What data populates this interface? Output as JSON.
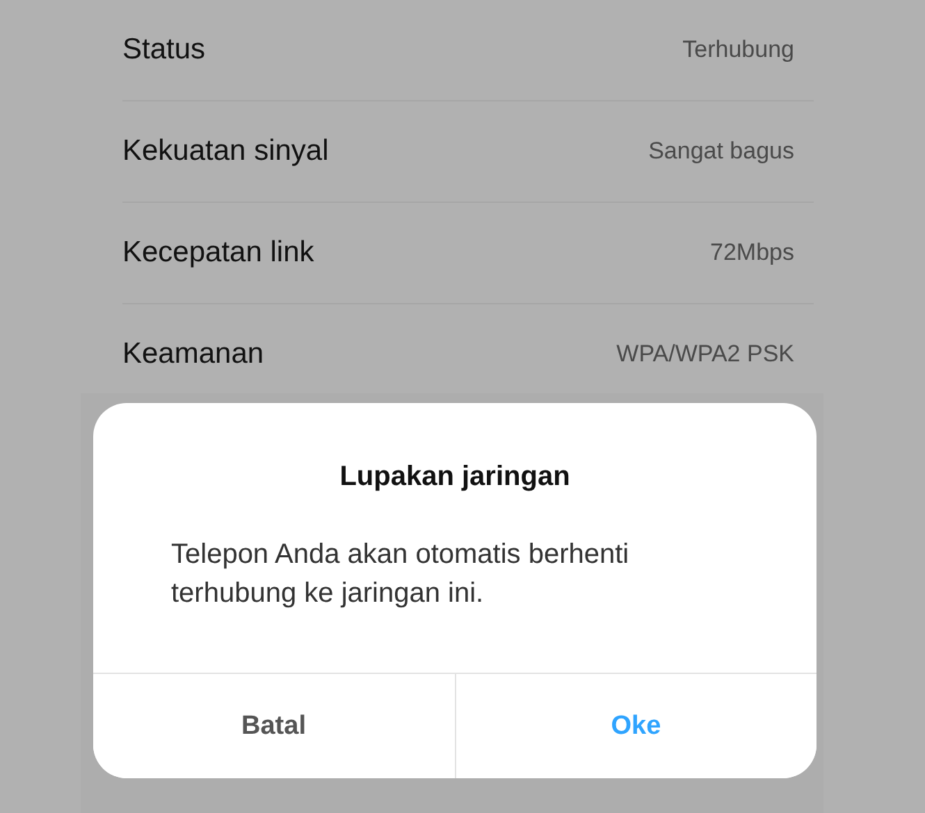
{
  "details": [
    {
      "label": "Status",
      "value": "Terhubung"
    },
    {
      "label": "Kekuatan sinyal",
      "value": "Sangat bagus"
    },
    {
      "label": "Kecepatan link",
      "value": "72Mbps"
    },
    {
      "label": "Keamanan",
      "value": "WPA/WPA2 PSK"
    }
  ],
  "dialog": {
    "title": "Lupakan jaringan",
    "message": "Telepon Anda akan otomatis berhenti terhubung ke jaringan ini.",
    "buttons": [
      {
        "label": "Batal",
        "kind": "cancel"
      },
      {
        "label": "Oke",
        "kind": "confirm"
      }
    ]
  }
}
